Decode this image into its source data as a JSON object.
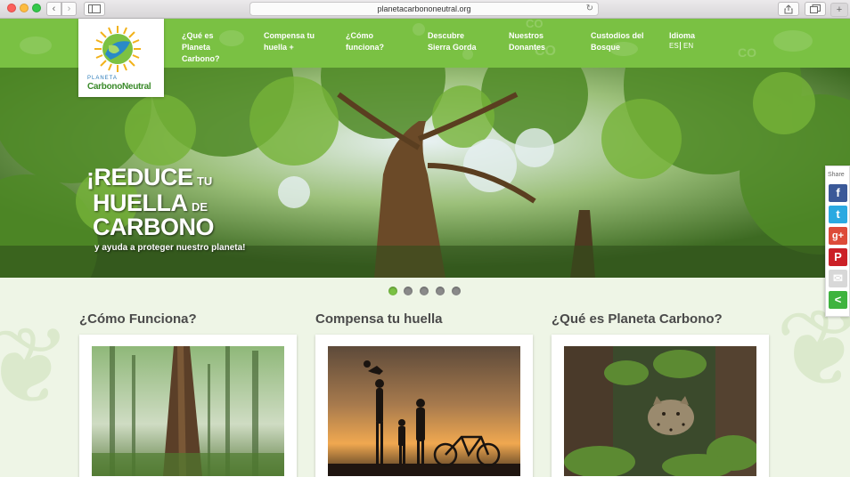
{
  "browser": {
    "url": "planetacarbononeutral.org",
    "back_glyph": "‹",
    "forward_glyph": "›",
    "plus_glyph": "+"
  },
  "logo": {
    "line1": "PLANETA",
    "line2": "CarbonoNeutral"
  },
  "nav": {
    "items": [
      {
        "label": "¿Qué es Planeta Carbono?"
      },
      {
        "label": "Compensa tu huella +"
      },
      {
        "label": "¿Cómo funciona?"
      },
      {
        "label": "Descubre Sierra Gorda"
      },
      {
        "label": "Nuestros Donantes"
      },
      {
        "label": "Custodios del Bosque"
      }
    ],
    "language": {
      "label": "Idioma",
      "es": "ES",
      "en": "EN"
    }
  },
  "hero": {
    "line1_big": "¡REDUCE",
    "line1_small": "TU",
    "line2_big": "HUELLA",
    "line2_small": "DE",
    "line3_big": "CARBONO",
    "subtitle": "y ayuda a proteger nuestro planeta!",
    "slides": 5,
    "active_slide": 1
  },
  "share": {
    "label": "Share",
    "buttons": [
      {
        "name": "facebook",
        "glyph": "f",
        "color": "#3b5998"
      },
      {
        "name": "twitter",
        "glyph": "t",
        "color": "#2ba9e1"
      },
      {
        "name": "google-plus",
        "glyph": "g+",
        "color": "#dd4b39"
      },
      {
        "name": "pinterest",
        "glyph": "P",
        "color": "#cb2027"
      },
      {
        "name": "email",
        "glyph": "✉",
        "color": "#d8d8d8"
      },
      {
        "name": "share-more",
        "glyph": "<",
        "color": "#3fb33f"
      }
    ]
  },
  "sections": [
    {
      "title": "¿Cómo Funciona?"
    },
    {
      "title": "Compensa tu huella"
    },
    {
      "title": "¿Qué es Planeta Carbono?"
    }
  ],
  "colors": {
    "brand_green": "#7ac143",
    "text_dark": "#4a4a4a"
  }
}
